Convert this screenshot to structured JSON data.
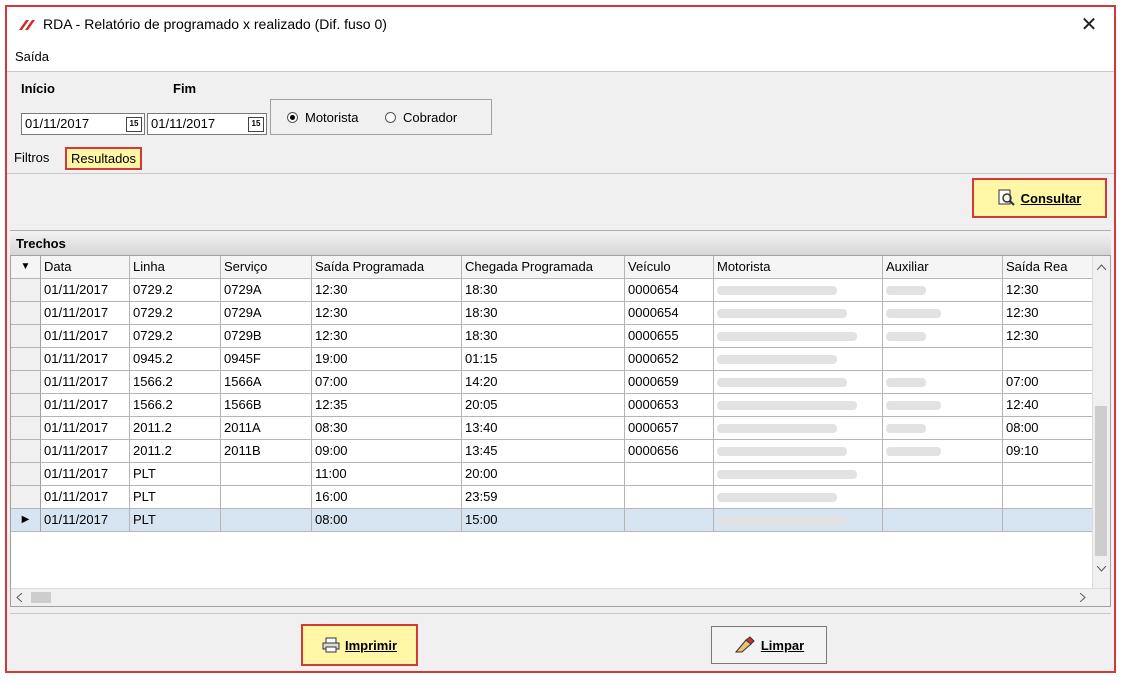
{
  "window": {
    "title": "RDA - Relatório de programado x realizado (Dif. fuso 0)",
    "close": "✕"
  },
  "menu": {
    "items": [
      "Saída"
    ]
  },
  "filters": {
    "inicio_label": "Início",
    "inicio_value": "01/11/2017",
    "fim_label": "Fim",
    "fim_value": "01/11/2017",
    "calendar_glyph": "15",
    "radio_motorista": "Motorista",
    "radio_cobrador": "Cobrador",
    "selected": "Motorista"
  },
  "tabs": [
    {
      "label": "Filtros",
      "active": false
    },
    {
      "label": "Resultados",
      "active": true
    }
  ],
  "toolbar": {
    "consultar_label": "Consultar"
  },
  "grid": {
    "caption": "Trechos",
    "columns": [
      "Data",
      "Linha",
      "Serviço",
      "Saída Programada",
      "Chegada Programada",
      "Veículo",
      "Motorista",
      "Auxiliar",
      "Saída Rea"
    ],
    "rows": [
      {
        "data": "01/11/2017",
        "linha": "0729.2",
        "servico": "0729A",
        "saida_prog": "12:30",
        "chegada_prog": "18:30",
        "veiculo": "0000654",
        "motorista": "",
        "auxiliar": "",
        "saida_real": "12:30"
      },
      {
        "data": "01/11/2017",
        "linha": "0729.2",
        "servico": "0729A",
        "saida_prog": "12:30",
        "chegada_prog": "18:30",
        "veiculo": "0000654",
        "motorista": "",
        "auxiliar": "",
        "saida_real": "12:30"
      },
      {
        "data": "01/11/2017",
        "linha": "0729.2",
        "servico": "0729B",
        "saida_prog": "12:30",
        "chegada_prog": "18:30",
        "veiculo": "0000655",
        "motorista": "",
        "auxiliar": "",
        "saida_real": "12:30"
      },
      {
        "data": "01/11/2017",
        "linha": "0945.2",
        "servico": "0945F",
        "saida_prog": "19:00",
        "chegada_prog": "01:15",
        "veiculo": "0000652",
        "motorista": "",
        "auxiliar": "",
        "saida_real": ""
      },
      {
        "data": "01/11/2017",
        "linha": "1566.2",
        "servico": "1566A",
        "saida_prog": "07:00",
        "chegada_prog": "14:20",
        "veiculo": "0000659",
        "motorista": "",
        "auxiliar": "",
        "saida_real": "07:00"
      },
      {
        "data": "01/11/2017",
        "linha": "1566.2",
        "servico": "1566B",
        "saida_prog": "12:35",
        "chegada_prog": "20:05",
        "veiculo": "0000653",
        "motorista": "",
        "auxiliar": "",
        "saida_real": "12:40"
      },
      {
        "data": "01/11/2017",
        "linha": "2011.2",
        "servico": "2011A",
        "saida_prog": "08:30",
        "chegada_prog": "13:40",
        "veiculo": "0000657",
        "motorista": "",
        "auxiliar": "",
        "saida_real": "08:00"
      },
      {
        "data": "01/11/2017",
        "linha": "2011.2",
        "servico": "2011B",
        "saida_prog": "09:00",
        "chegada_prog": "13:45",
        "veiculo": "0000656",
        "motorista": "",
        "auxiliar": "",
        "saida_real": "09:10"
      },
      {
        "data": "01/11/2017",
        "linha": "PLT",
        "servico": "",
        "saida_prog": "11:00",
        "chegada_prog": "20:00",
        "veiculo": "",
        "motorista": "",
        "auxiliar": "",
        "saida_real": ""
      },
      {
        "data": "01/11/2017",
        "linha": "PLT",
        "servico": "",
        "saida_prog": "16:00",
        "chegada_prog": "23:59",
        "veiculo": "",
        "motorista": "",
        "auxiliar": "",
        "saida_real": ""
      },
      {
        "data": "01/11/2017",
        "linha": "PLT",
        "servico": "",
        "saida_prog": "08:00",
        "chegada_prog": "15:00",
        "veiculo": "",
        "motorista": "",
        "auxiliar": "",
        "saida_real": ""
      }
    ],
    "selected_row": 10
  },
  "footer": {
    "imprimir_label": "Imprimir",
    "limpar_label": "Limpar"
  },
  "colors": {
    "highlight_border": "#d23a3a",
    "highlight_fill": "#fff6a6",
    "selected_row": "#d7e4f2"
  },
  "icons": [
    "app-logo-icon",
    "calendar-icon",
    "search-icon",
    "printer-icon",
    "eraser-icon",
    "close-icon",
    "sort-arrow-icon",
    "row-pointer-icon",
    "scroll-up-icon",
    "scroll-down-icon",
    "scroll-left-icon",
    "scroll-right-icon"
  ]
}
